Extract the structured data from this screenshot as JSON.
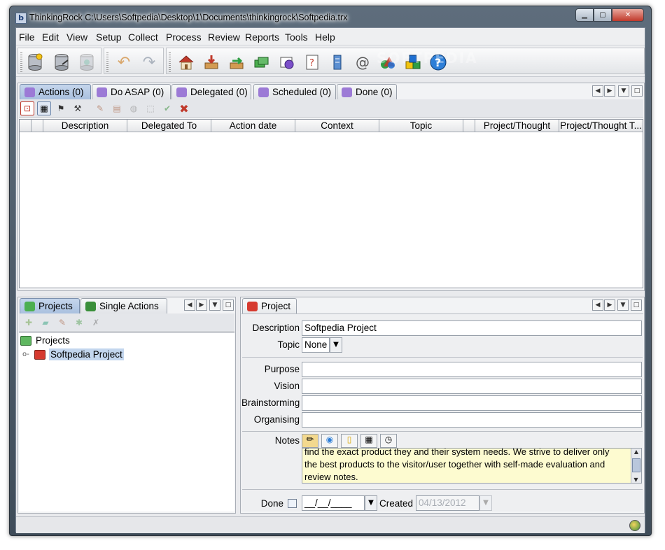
{
  "window": {
    "title": "ThinkingRock C:\\Users\\Softpedia\\Desktop\\1\\Documents\\thinkingrock\\Softpedia.trx",
    "app_icon": "thinkingrock-icon"
  },
  "menu": [
    "File",
    "Edit",
    "View",
    "Setup",
    "Collect",
    "Process",
    "Review",
    "Reports",
    "Tools",
    "Help"
  ],
  "toolbar_icons": [
    "database-open-icon",
    "database-save-icon",
    "database-disabled-icon",
    "undo-icon",
    "redo-icon",
    "home-icon",
    "collect-icon",
    "process-icon",
    "review-icon",
    "projects-icon",
    "reports-icon",
    "organise-icon",
    "email-icon",
    "shapes-icon",
    "cubes-icon",
    "help-icon"
  ],
  "actions_tabs": [
    "Actions (0)",
    "Do ASAP (0)",
    "Delegated (0)",
    "Scheduled (0)",
    "Done (0)"
  ],
  "actions_columns": [
    "Description",
    "Delegated To",
    "Action date",
    "Context",
    "Topic",
    "Project/Thought",
    "Project/Thought T..."
  ],
  "projects_panel": {
    "tabs": [
      "Projects",
      "Single Actions"
    ],
    "root": "Projects",
    "items": [
      "Softpedia Project"
    ]
  },
  "project_panel": {
    "tab": "Project",
    "labels": {
      "description": "Description",
      "topic": "Topic",
      "purpose": "Purpose",
      "vision": "Vision",
      "brainstorming": "Brainstorming",
      "organising": "Organising",
      "notes": "Notes",
      "done": "Done",
      "created": "Created"
    },
    "description": "Softpedia Project",
    "topic": "None",
    "purpose": "",
    "vision": "",
    "brainstorming": "",
    "organising": "",
    "notes_lines": [
      "find the exact product they and their system needs. We strive to deliver only",
      "the best products to the visitor/user together with self-made evaluation and",
      "review notes."
    ],
    "done_date": "__/__/____",
    "created_date": "04/13/2012"
  },
  "watermark": "SOFTPEDIA",
  "colors": {
    "accent": "#a9c0df",
    "notes_bg": "#fdfbd0",
    "selection": "#c3d6ee"
  }
}
